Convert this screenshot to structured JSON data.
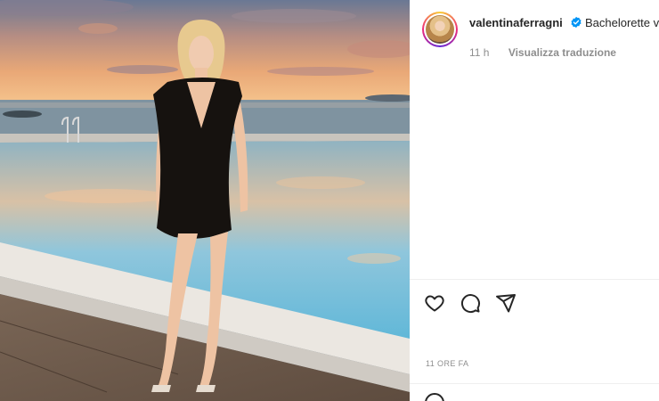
{
  "post": {
    "image_alt": "Woman in black dress standing by infinity pool at sunset"
  },
  "author": {
    "username": "valentinaferragni",
    "verified": true,
    "caption_preview": "Bachelorette v"
  },
  "meta": {
    "time_short": "11 h",
    "translate_label": "Visualizza traduzione"
  },
  "footer": {
    "time_ago": "11 ORE FA"
  },
  "icons": {
    "like": "heart-icon",
    "comment": "comment-icon",
    "share": "send-icon",
    "emoji": "emoji-icon"
  },
  "colors": {
    "text": "#262626",
    "muted": "#8e8e8e",
    "verified": "#0095f6"
  }
}
